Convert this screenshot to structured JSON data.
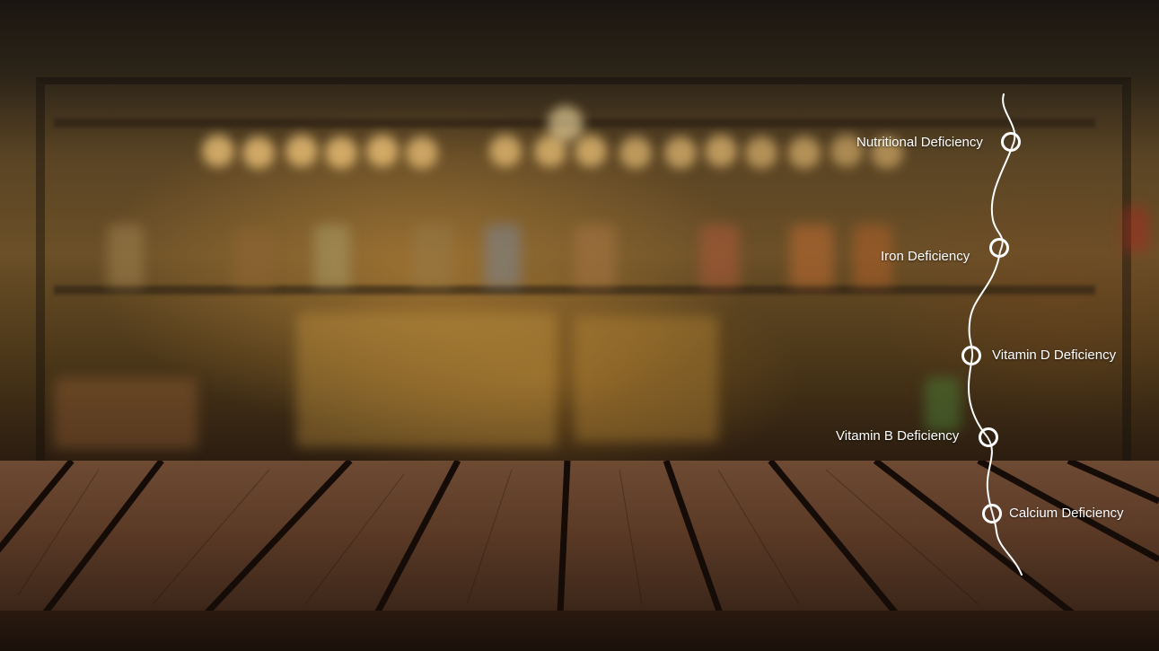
{
  "timeline": {
    "items": [
      {
        "label": "Nutritional Deficiency"
      },
      {
        "label": "Iron Deficiency"
      },
      {
        "label": "Vitamin D Deficiency"
      },
      {
        "label": "Vitamin B Deficiency"
      },
      {
        "label": "Calcium Deficiency"
      }
    ],
    "line_color": "#ffffff"
  },
  "scene": {
    "background": "blurred bar shelves with bottles",
    "foreground": "wooden tabletop"
  }
}
